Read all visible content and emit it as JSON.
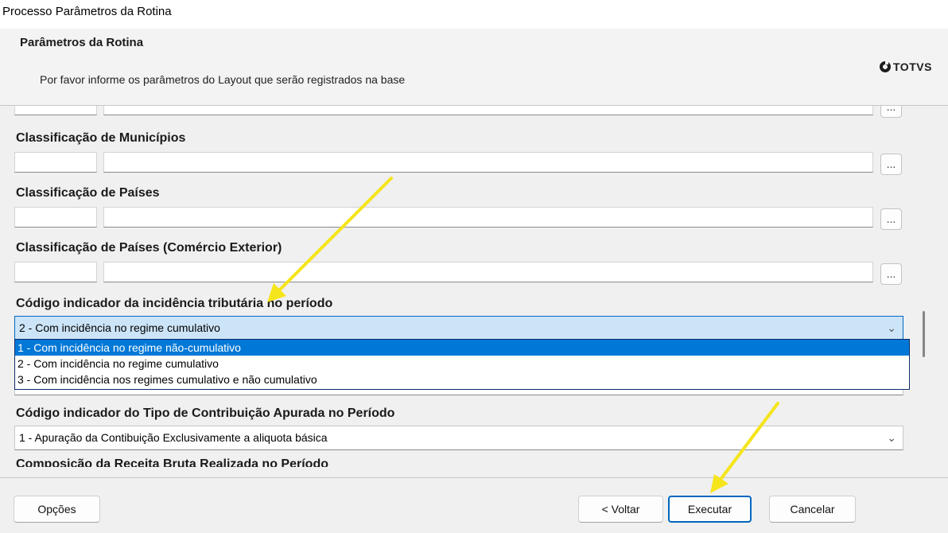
{
  "window": {
    "title": "Processo Parâmetros da Rotina"
  },
  "header": {
    "title": "Parâmetros da Rotina",
    "subtitle": "Por favor informe os parâmetros do Layout que serão registrados na base",
    "logo_text": "TOTVS"
  },
  "fields": {
    "municipios_label": "Classificação de Municípios",
    "paises_label": "Classificação de Países",
    "paises_ce_label": "Classificação de Países (Comércio Exterior)",
    "incidencia_label": "Código indicador da incidência tributária no período",
    "incidencia_value": "2 - Com incidência no regime cumulativo",
    "tipo_contrib_label": "Código indicador do Tipo de Contribuição Apurada no Período",
    "tipo_contrib_value": "1 - Apuração da Contibuição Exclusivamente a aliquota básica",
    "lookup_label": "...",
    "cut_label": "Composição da Receita Bruta Realizada no Período"
  },
  "dropdown": {
    "options": [
      "1 - Com incidência no regime não-cumulativo",
      "2 - Com incidência no regime cumulativo",
      "3 - Com incidência nos regimes cumulativo e não cumulativo"
    ],
    "highlighted_index": 0
  },
  "footer": {
    "options_label": "Opções",
    "back_label": "< Voltar",
    "execute_label": "Executar",
    "cancel_label": "Cancelar"
  },
  "colors": {
    "accent": "#0078d7",
    "annotation_arrow": "#f5e51b"
  },
  "icons": [
    "totvs-logo-icon",
    "chevron-down-icon"
  ]
}
